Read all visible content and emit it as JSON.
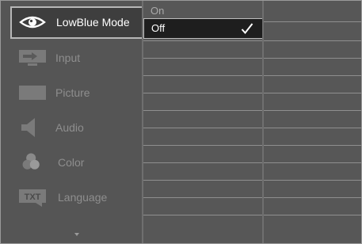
{
  "menu": {
    "items": [
      {
        "label": "LowBlue Mode",
        "icon": "eye-icon",
        "selected": true
      },
      {
        "label": "Input",
        "icon": "input-icon",
        "selected": false
      },
      {
        "label": "Picture",
        "icon": "picture-icon",
        "selected": false
      },
      {
        "label": "Audio",
        "icon": "speaker-icon",
        "selected": false
      },
      {
        "label": "Color",
        "icon": "color-icon",
        "selected": false
      },
      {
        "label": "Language",
        "icon": "language-icon",
        "selected": false
      }
    ],
    "more_icon": "chevron-down-icon"
  },
  "language_icon_text": "TXT",
  "submenu": {
    "options": [
      {
        "label": "On",
        "selected": false
      },
      {
        "label": "Off",
        "selected": true
      }
    ],
    "selected_icon": "check-icon"
  },
  "colors": {
    "background": "#636363",
    "selected_item_bg": "#3e3e3e",
    "selected_border": "#b7b7b7",
    "text_active": "#ffffff",
    "text_inactive": "#8e8e8e"
  }
}
